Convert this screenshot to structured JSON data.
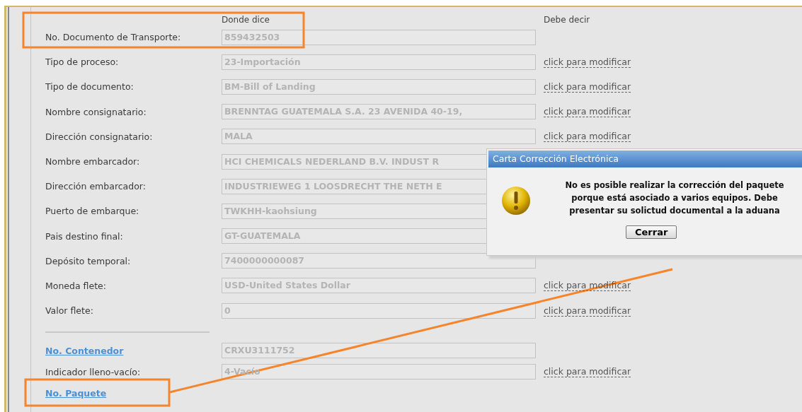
{
  "columns": {
    "current": "Donde dice",
    "corrected": "Debe decir"
  },
  "fields": [
    {
      "kind": "text",
      "label": "No. Documento de Transporte:",
      "value": "859432503"
    },
    {
      "kind": "text",
      "label": "Tipo de proceso:",
      "value": "23-Importación",
      "action": "click para modificar"
    },
    {
      "kind": "text",
      "label": "Tipo de documento:",
      "value": "BM-Bill of Landing",
      "action": "click para modificar"
    },
    {
      "kind": "text",
      "label": "Nombre consignatario:",
      "value": "BRENNTAG GUATEMALA S.A. 23 AVENIDA 40-19,",
      "action": "click para modificar"
    },
    {
      "kind": "text",
      "label": "Dirección consignatario:",
      "value": "MALA",
      "action": "click para modificar"
    },
    {
      "kind": "text",
      "label": "Nombre embarcador:",
      "value": "HCI CHEMICALS NEDERLAND B.V. INDUST R"
    },
    {
      "kind": "text",
      "label": "Dirección embarcador:",
      "value": "INDUSTRIEWEG 1 LOOSDRECHT THE NETH E"
    },
    {
      "kind": "text",
      "label": "Puerto de embarque:",
      "value": "TWKHH-kaohsiung"
    },
    {
      "kind": "text",
      "label": "Pais destino final:",
      "value": "GT-GUATEMALA"
    },
    {
      "kind": "text",
      "label": "Depósito temporal:",
      "value": "7400000000087"
    },
    {
      "kind": "text",
      "label": "Moneda flete:",
      "value": "USD-United States Dollar",
      "action": "click para modificar"
    },
    {
      "kind": "text",
      "label": "Valor flete:",
      "value": "0",
      "action": "click para modificar"
    }
  ],
  "container_fields": [
    {
      "kind": "link",
      "label": "No. Contenedor",
      "value": "CRXU3111752"
    },
    {
      "kind": "text",
      "label": "Indicador lleno-vacío:",
      "value": "4-Vacío",
      "action": "click para modificar"
    },
    {
      "kind": "link",
      "label": "No. Paquete"
    }
  ],
  "dialog": {
    "title": "Carta Corrección Electrónica",
    "message": "No es posible realizar la corrección del paquete\nporque está asociado a varios equipos. Debe\npresentar su solictud documental a la aduana",
    "button": "Cerrar"
  }
}
